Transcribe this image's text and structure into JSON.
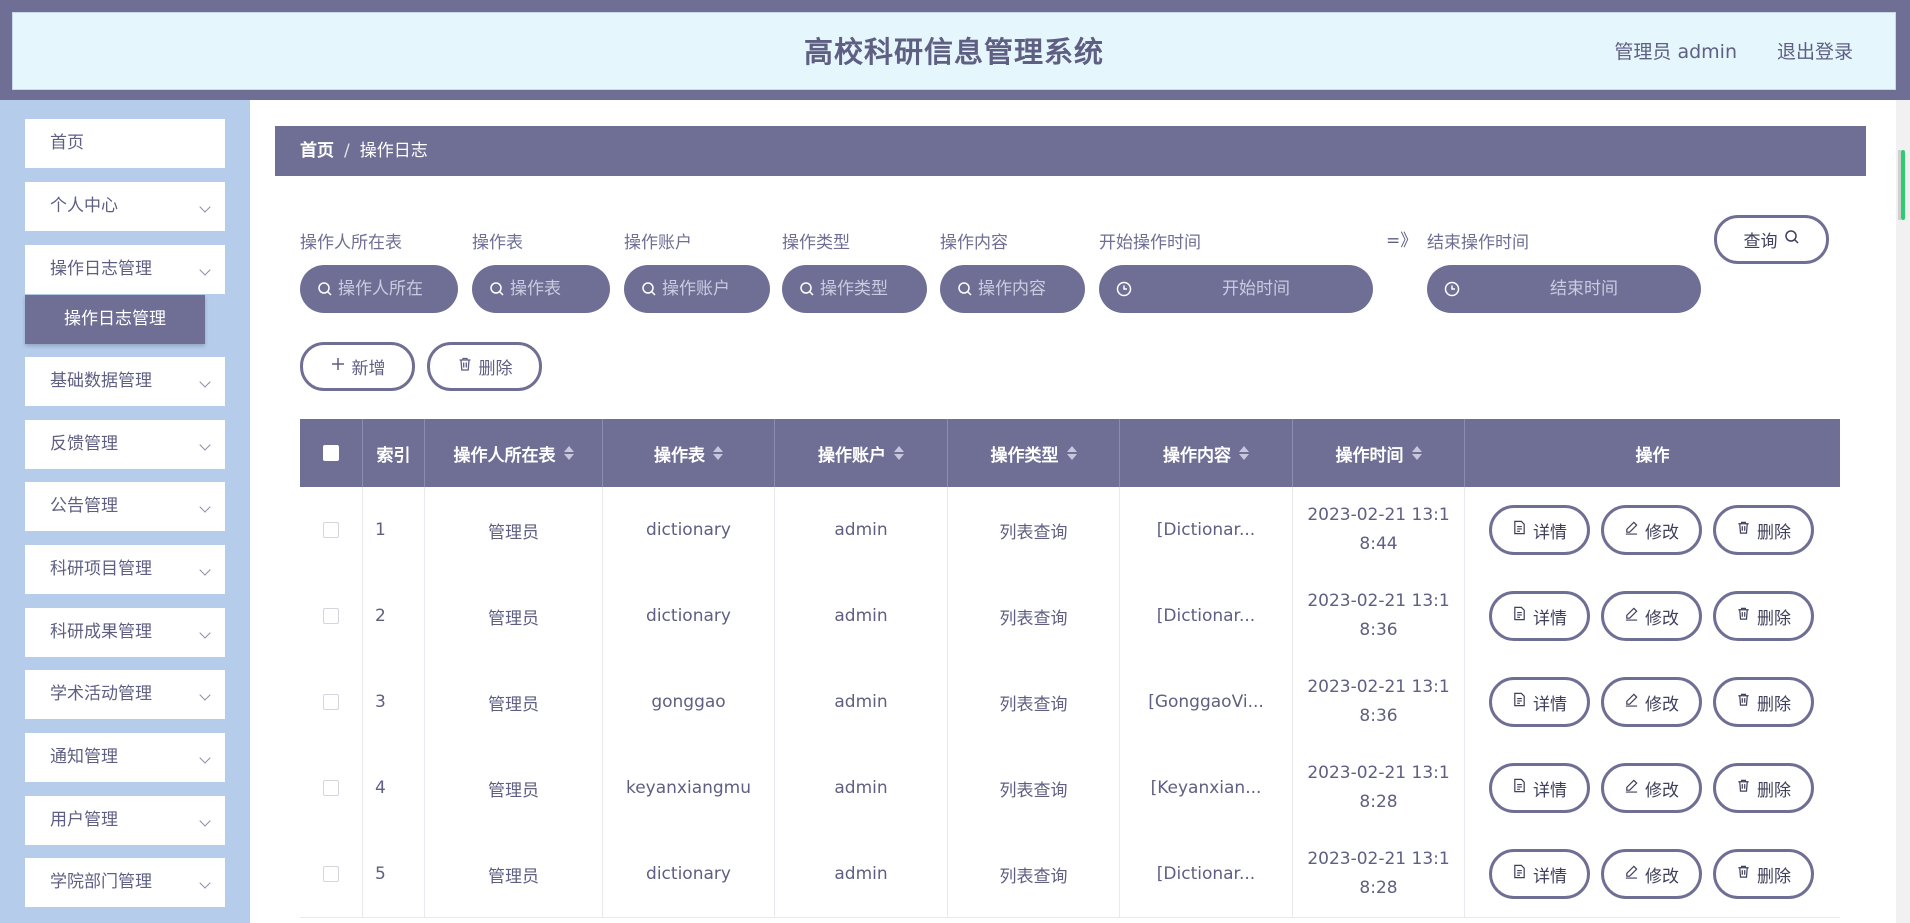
{
  "header": {
    "title": "高校科研信息管理系统",
    "user_label": "管理员 admin",
    "logout_label": "退出登录"
  },
  "sidebar": {
    "items": [
      {
        "label": "首页",
        "has_chevron": false
      },
      {
        "label": "个人中心",
        "has_chevron": true
      },
      {
        "label": "操作日志管理",
        "has_chevron": true
      },
      {
        "label": "基础数据管理",
        "has_chevron": true
      },
      {
        "label": "反馈管理",
        "has_chevron": true
      },
      {
        "label": "公告管理",
        "has_chevron": true
      },
      {
        "label": "科研项目管理",
        "has_chevron": true
      },
      {
        "label": "科研成果管理",
        "has_chevron": true
      },
      {
        "label": "学术活动管理",
        "has_chevron": true
      },
      {
        "label": "通知管理",
        "has_chevron": true
      },
      {
        "label": "用户管理",
        "has_chevron": true
      },
      {
        "label": "学院部门管理",
        "has_chevron": true
      }
    ],
    "active_sub": "操作日志管理"
  },
  "breadcrumb": {
    "home": "首页",
    "separator": "/",
    "current": "操作日志"
  },
  "filters": {
    "fields": [
      {
        "label": "操作人所在表",
        "placeholder": "操作人所在"
      },
      {
        "label": "操作表",
        "placeholder": "操作表"
      },
      {
        "label": "操作账户",
        "placeholder": "操作账户"
      },
      {
        "label": "操作类型",
        "placeholder": "操作类型"
      },
      {
        "label": "操作内容",
        "placeholder": "操作内容"
      }
    ],
    "start_label": "开始操作时间",
    "start_placeholder": "开始时间",
    "range_arrow": "=》",
    "end_label": "结束操作时间",
    "end_placeholder": "结束时间",
    "query_label": "查询"
  },
  "toolbar": {
    "add_label": "新增",
    "delete_label": "删除"
  },
  "table": {
    "headers": [
      "索引",
      "操作人所在表",
      "操作表",
      "操作账户",
      "操作类型",
      "操作内容",
      "操作时间",
      "操作"
    ],
    "rows": [
      {
        "index": "1",
        "operator_table": "管理员",
        "table": "dictionary",
        "account": "admin",
        "type": "列表查询",
        "content": "[Dictionar...",
        "time": "2023-02-21 13:18:44"
      },
      {
        "index": "2",
        "operator_table": "管理员",
        "table": "dictionary",
        "account": "admin",
        "type": "列表查询",
        "content": "[Dictionar...",
        "time": "2023-02-21 13:18:36"
      },
      {
        "index": "3",
        "operator_table": "管理员",
        "table": "gonggao",
        "account": "admin",
        "type": "列表查询",
        "content": "[GonggaoVi...",
        "time": "2023-02-21 13:18:36"
      },
      {
        "index": "4",
        "operator_table": "管理员",
        "table": "keyanxiangmu",
        "account": "admin",
        "type": "列表查询",
        "content": "[Keyanxian...",
        "time": "2023-02-21 13:18:28"
      },
      {
        "index": "5",
        "operator_table": "管理员",
        "table": "dictionary",
        "account": "admin",
        "type": "列表查询",
        "content": "[Dictionar...",
        "time": "2023-02-21 13:18:28"
      }
    ],
    "actions": {
      "detail": "详情",
      "edit": "修改",
      "delete": "删除"
    }
  },
  "colors": {
    "accent": "#6f6f95",
    "sidebar_bg": "#b5cdeb",
    "header_bg": "#e6f6fd"
  },
  "icons": {
    "search": "search-icon",
    "clock": "clock-icon",
    "plus": "plus-icon",
    "trash": "trash-icon",
    "doc": "document-icon",
    "pencil": "pencil-icon"
  }
}
